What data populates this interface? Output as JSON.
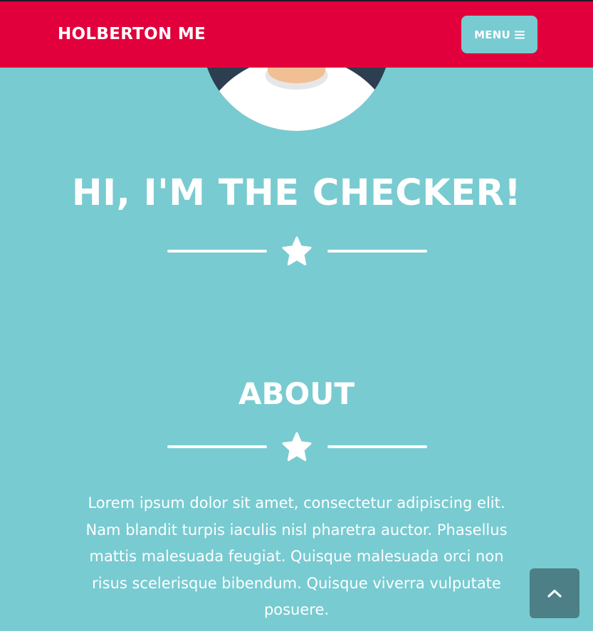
{
  "navbar": {
    "brand": "HOLBERTON ME",
    "menu_label": "MENU",
    "menu_icon": "hamburger-icon"
  },
  "hero": {
    "avatar": "avatar-illustration",
    "title": "HI, I'M THE CHECKER!",
    "divider_icon": "star-icon"
  },
  "about": {
    "title": "ABOUT",
    "divider_icon": "star-icon",
    "paragraph": "Lorem ipsum dolor sit amet, consectetur adipiscing elit. Nam blandit turpis iaculis nisl pharetra auctor. Phasellus mattis malesuada feugiat. Quisque malesuada orci non risus scelerisque bibendum. Quisque viverra vulputate posuere."
  },
  "scroll_top": {
    "icon": "chevron-up-icon"
  },
  "colors": {
    "page_background": "#78cbd1",
    "navbar_background": "#e1003b",
    "scroll_button_background": "#4d7f86",
    "text": "#ffffff"
  }
}
